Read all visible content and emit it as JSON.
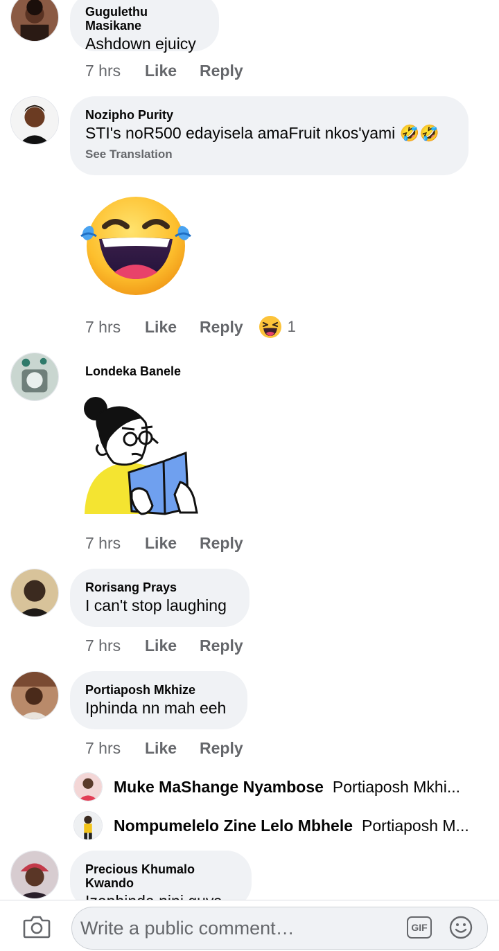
{
  "comments": [
    {
      "author": "Gugulethu Masikane",
      "text": "Ashdown ejuicy",
      "time": "7 hrs",
      "like": "Like",
      "reply": "Reply"
    },
    {
      "author": "Nozipho Purity",
      "text": "STI's noR500 edayisela amaFruit nkos'yami 🤣🤣",
      "see_translation": "See Translation",
      "time": "7 hrs",
      "like": "Like",
      "reply": "Reply",
      "reaction_count": "1",
      "reaction_icon": "laughing-reaction-icon"
    },
    {
      "author": "Londeka Banele",
      "time": "7 hrs",
      "like": "Like",
      "reply": "Reply"
    },
    {
      "author": "Rorisang Prays",
      "text": "I can't stop laughing",
      "time": "7 hrs",
      "like": "Like",
      "reply": "Reply"
    },
    {
      "author": "Portiaposh Mkhize",
      "text": "Iphinda nn mah eeh",
      "time": "7 hrs",
      "like": "Like",
      "reply": "Reply"
    },
    {
      "author": "Precious Khumalo Kwando",
      "text": "Izophinda nini guys"
    }
  ],
  "replies": [
    {
      "author": "Muke MaShange Nyambose",
      "text": "Portiaposh Mkhi..."
    },
    {
      "author": "Nompumelelo Zine Lelo Mbhele",
      "text": "Portiaposh M..."
    }
  ],
  "composer": {
    "placeholder": "Write a public comment…",
    "gif_label": "GIF"
  },
  "colors": {
    "bubble": "#f0f2f5",
    "secondary_text": "#65676b",
    "primary_text": "#050505"
  }
}
